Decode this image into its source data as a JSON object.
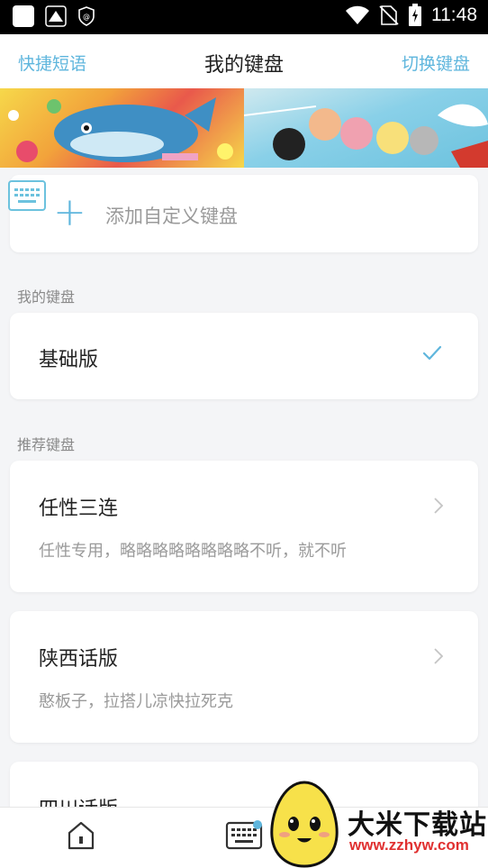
{
  "status_bar": {
    "time": "11:48"
  },
  "header": {
    "left_link": "快捷短语",
    "title": "我的键盘",
    "right_link": "切换键盘"
  },
  "add_card": {
    "label": "添加自定义键盘",
    "plus": "+"
  },
  "sections": {
    "mine": "我的键盘",
    "recommended": "推荐键盘"
  },
  "my_keyboards": [
    {
      "name": "基础版",
      "selected": true
    }
  ],
  "recommended_keyboards": [
    {
      "name": "任性三连",
      "desc": "任性专用，略略略略略略略略不听，就不听"
    },
    {
      "name": "陕西话版",
      "desc": "憨板子，拉搭儿凉快拉死克"
    },
    {
      "name": "四川话版",
      "desc": ""
    }
  ],
  "watermark": {
    "brand": "大米下载站",
    "url": "www.zzhyw.com"
  },
  "colors": {
    "accent": "#5fb6dd",
    "text": "#222222",
    "muted": "#9a9a9a",
    "background": "#f4f5f7"
  },
  "icons": [
    "app-icon",
    "notification-icon",
    "vpn-icon",
    "wifi-icon",
    "no-sim-icon",
    "battery-icon",
    "keyboard-icon",
    "check-icon",
    "chevron-right-icon",
    "home-icon"
  ]
}
